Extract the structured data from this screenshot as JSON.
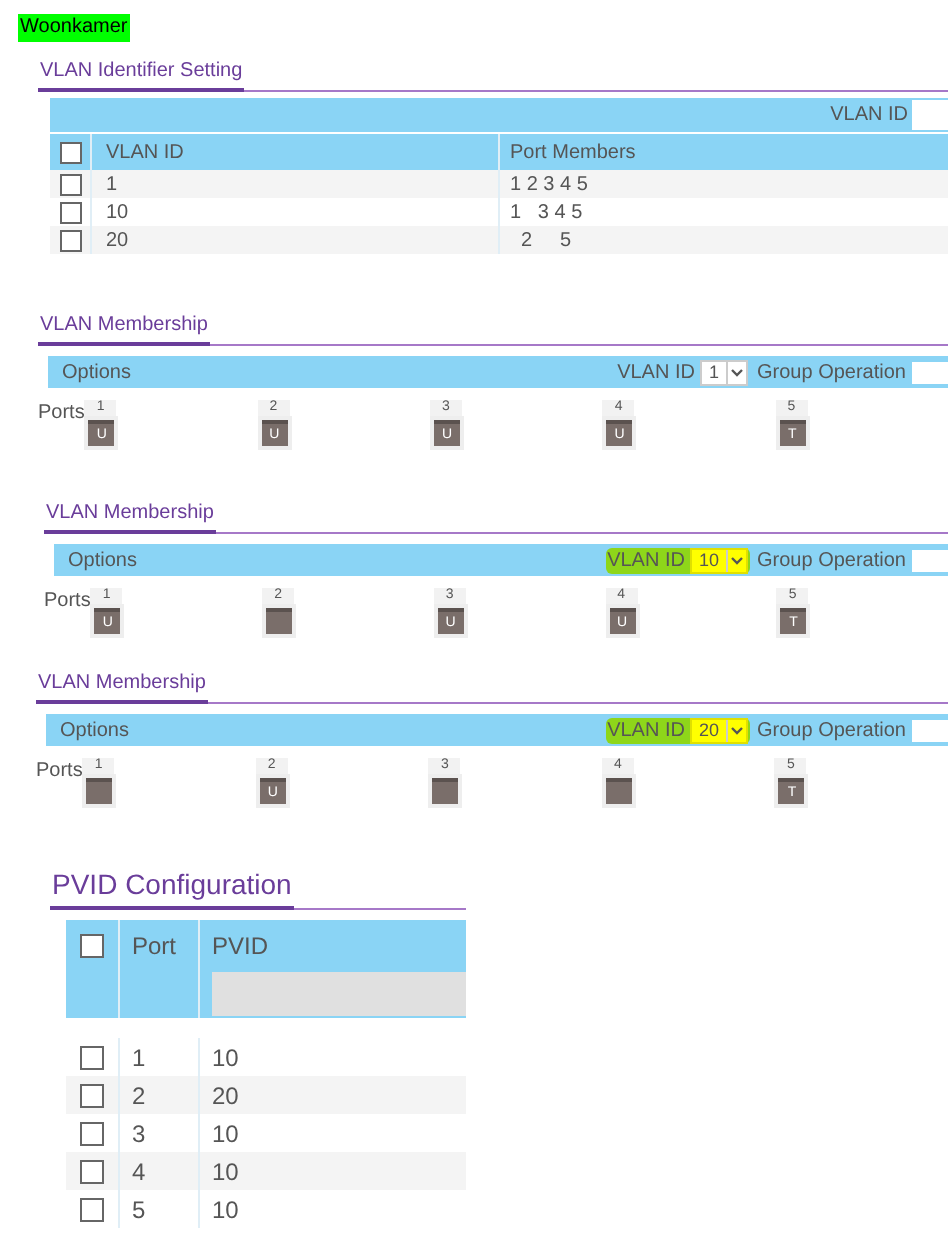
{
  "badge": "Woonkamer",
  "vlan_identifier": {
    "title": "VLAN Identifier Setting",
    "filter_label": "VLAN ID",
    "header_checkbox": {
      "checked": false
    },
    "columns": [
      "VLAN ID",
      "Port Members"
    ],
    "rows": [
      {
        "checked": false,
        "vlan_id": "1",
        "port_members": "1 2 3 4 5"
      },
      {
        "checked": false,
        "vlan_id": "10",
        "port_members": "1   3 4 5"
      },
      {
        "checked": false,
        "vlan_id": "20",
        "port_members": "  2     5"
      }
    ]
  },
  "memberships": [
    {
      "title": "VLAN Membership",
      "options_label": "Options",
      "vlan_label": "VLAN ID",
      "vlan_value": "1",
      "highlighted": false,
      "group_label": "Group Operation",
      "ports_label": "Ports",
      "ports": [
        {
          "label": "1",
          "tag": "U"
        },
        {
          "label": "2",
          "tag": "U"
        },
        {
          "label": "3",
          "tag": "U"
        },
        {
          "label": "4",
          "tag": "U"
        },
        {
          "label": "5",
          "tag": "T"
        }
      ]
    },
    {
      "title": "VLAN Membership",
      "options_label": "Options",
      "vlan_label": "VLAN ID",
      "vlan_value": "10",
      "highlighted": true,
      "group_label": "Group Operation",
      "ports_label": "Ports",
      "ports": [
        {
          "label": "1",
          "tag": "U"
        },
        {
          "label": "2"
        },
        {
          "label": "3",
          "tag": "U"
        },
        {
          "label": "4",
          "tag": "U"
        },
        {
          "label": "5",
          "tag": "T"
        }
      ]
    },
    {
      "title": "VLAN Membership",
      "options_label": "Options",
      "vlan_label": "VLAN ID",
      "vlan_value": "20",
      "highlighted": true,
      "group_label": "Group Operation",
      "ports_label": "Ports",
      "ports": [
        {
          "label": "1"
        },
        {
          "label": "2",
          "tag": "U"
        },
        {
          "label": "3"
        },
        {
          "label": "4"
        },
        {
          "label": "5",
          "tag": "T"
        }
      ]
    }
  ],
  "pvid": {
    "title": "PVID Configuration",
    "header_checkbox": {
      "checked": false
    },
    "columns": [
      "Port",
      "PVID"
    ],
    "rows": [
      {
        "checked": false,
        "port": "1",
        "pvid": "10"
      },
      {
        "checked": false,
        "port": "2",
        "pvid": "20"
      },
      {
        "checked": false,
        "port": "3",
        "pvid": "10"
      },
      {
        "checked": false,
        "port": "4",
        "pvid": "10"
      },
      {
        "checked": false,
        "port": "5",
        "pvid": "10"
      }
    ]
  }
}
